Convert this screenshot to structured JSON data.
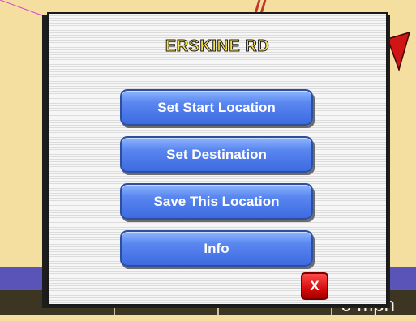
{
  "dialog": {
    "title": "ERSKINE RD",
    "buttons": [
      {
        "label": "Set Start Location"
      },
      {
        "label": "Set Destination"
      },
      {
        "label": "Save This Location"
      },
      {
        "label": "Info"
      }
    ],
    "close_label": "X"
  },
  "status": {
    "speed": "0 mph"
  },
  "colors": {
    "map_background": "#f5dfa0",
    "route_band": "#5a53b8",
    "button_blue": "#4a78e8",
    "title_yellow": "#f7e24a",
    "close_red": "#d40c0c"
  }
}
